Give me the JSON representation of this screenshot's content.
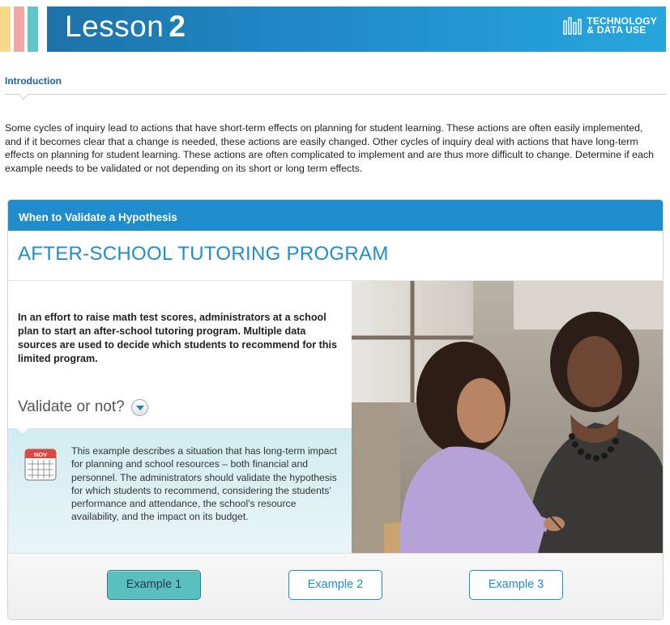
{
  "header": {
    "lesson_word": "Lesson",
    "lesson_number": "2",
    "brand_line1": "TECHNOLOGY",
    "brand_line2": "& DATA USE",
    "stripe_colors": [
      "#f7d98a",
      "#f4a7a7",
      "#5fc6c9"
    ],
    "bar_color": "#1f86c2"
  },
  "intro": {
    "label": "Introduction",
    "text": "Some cycles of inquiry lead to actions that have short-term effects on planning for student learning. These actions are often easily implemented, and if it becomes clear that a change is needed, these actions are easily changed. Other cycles of inquiry deal with actions that have long-term effects on planning for student learning. These actions are often complicated to implement and are thus more difficult to change. Determine if each example needs to be validated or not depending on its short or long term effects."
  },
  "panel": {
    "title": "When to Validate a Hypothesis",
    "example_title": "AFTER-SCHOOL TUTORING PROGRAM",
    "scenario": "In an effort to raise math test scores, administrators at a school plan to start an after-school tutoring program. Multiple data sources are used to decide which students to recommend for this limited program.",
    "validate_label": "Validate or not?",
    "calendar_month": "NOV",
    "answer": "This example describes a situation that has long-term impact for planning and school resources – both financial and personnel. The administrators should validate the hypothesis for which students to recommend, considering the students' performance and attendance, the school's resource availability, and the impact on its budget.",
    "accent_color": "#1f8ccb"
  },
  "tabs": [
    {
      "label": "Example 1",
      "active": true
    },
    {
      "label": "Example 2",
      "active": false
    },
    {
      "label": "Example 3",
      "active": false
    }
  ]
}
